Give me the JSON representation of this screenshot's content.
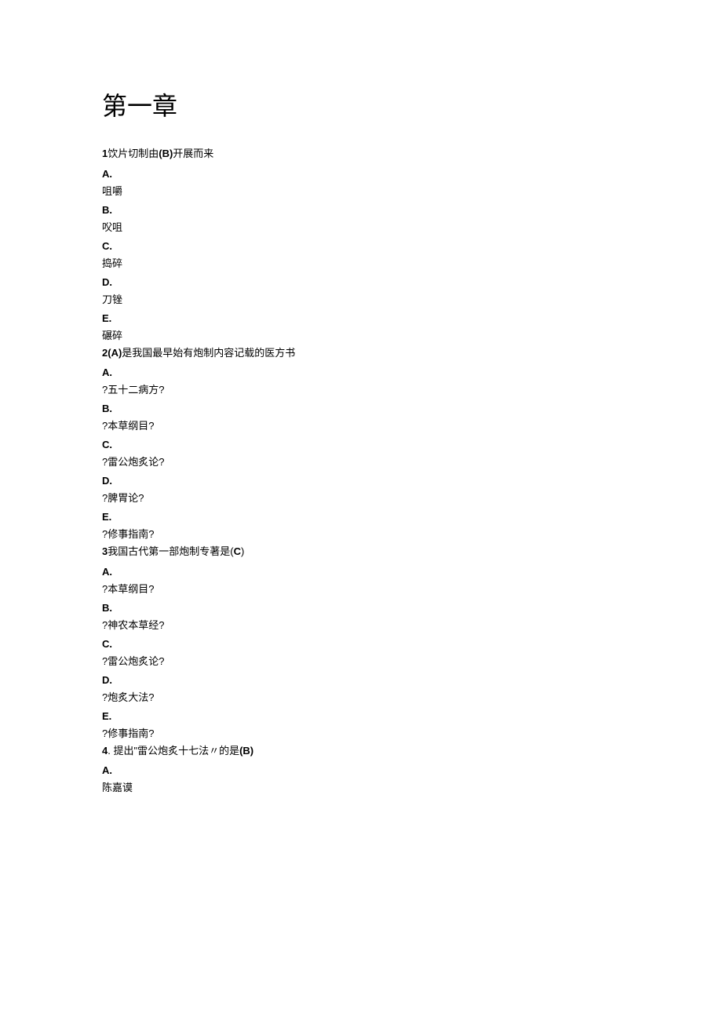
{
  "chapter_title": "第一章",
  "questions": [
    {
      "num": "1",
      "text_before": "饮片切制由",
      "answer": "(B)",
      "text_after": "开展而来",
      "options": [
        {
          "letter": "A.",
          "text": "咀嚼"
        },
        {
          "letter": "B.",
          "text": "㕮咀"
        },
        {
          "letter": "C.",
          "text": "捣碎"
        },
        {
          "letter": "D.",
          "text": "刀锉"
        },
        {
          "letter": "E.",
          "text": "碾碎"
        }
      ]
    },
    {
      "num": "2",
      "answer": "(A)",
      "text_after": "是我国最早始有炮制内容记载的医方书",
      "options": [
        {
          "letter": "A.",
          "text": "?五十二病方?"
        },
        {
          "letter": "B.",
          "text": "?本草纲目?"
        },
        {
          "letter": "C.",
          "text": "?雷公炮炙论?"
        },
        {
          "letter": "D.",
          "text": "?脾胃论?"
        },
        {
          "letter": "E.",
          "text": "?修事指南?"
        }
      ]
    },
    {
      "num": "3",
      "text_before": "我国古代第一部炮制专著是(",
      "answer": "C",
      "text_after": ")",
      "options": [
        {
          "letter": "A.",
          "text": "?本草纲目?"
        },
        {
          "letter": "B.",
          "text": "?神农本草经?"
        },
        {
          "letter": "C.",
          "text": "?雷公炮炙论?"
        },
        {
          "letter": "D.",
          "text": "?炮炙大法?"
        },
        {
          "letter": "E.",
          "text": "?修事指南?"
        }
      ]
    },
    {
      "num": "4",
      "text_before": ". 提出\"雷公炮炙十七法〃的是",
      "answer": "(B)",
      "text_after": "",
      "options": [
        {
          "letter": "A.",
          "text": "陈嘉谟"
        }
      ]
    }
  ]
}
